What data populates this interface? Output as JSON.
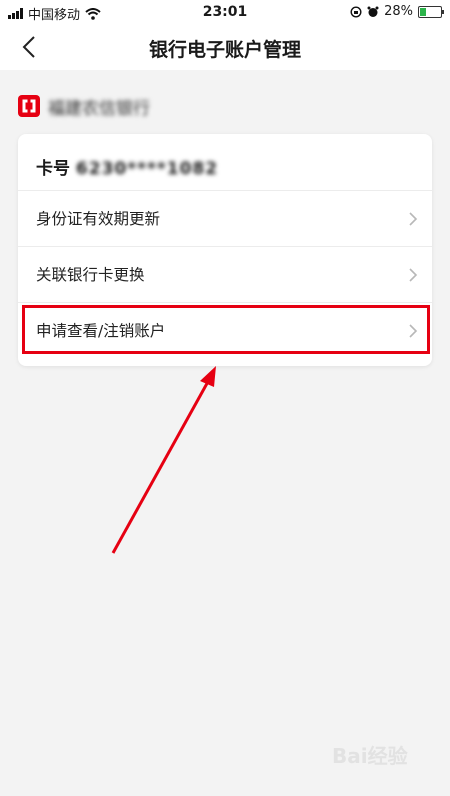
{
  "status_bar": {
    "carrier": "中国移动",
    "time": "23:01",
    "battery_percent": "28%",
    "battery_level": 0.28
  },
  "navbar": {
    "title": "银行电子账户管理",
    "back_icon": "chevron-left-icon"
  },
  "bank": {
    "name": "福建农信银行",
    "logo_color": "#e60012"
  },
  "card": {
    "number_label": "卡号",
    "number_masked": "6230****1082",
    "items": [
      {
        "label": "身份证有效期更新"
      },
      {
        "label": "关联银行卡更换"
      },
      {
        "label": "申请查看/注销账户"
      }
    ]
  },
  "annotation": {
    "highlight_color": "#e60012"
  },
  "watermark": {
    "text": "Bai经验"
  }
}
